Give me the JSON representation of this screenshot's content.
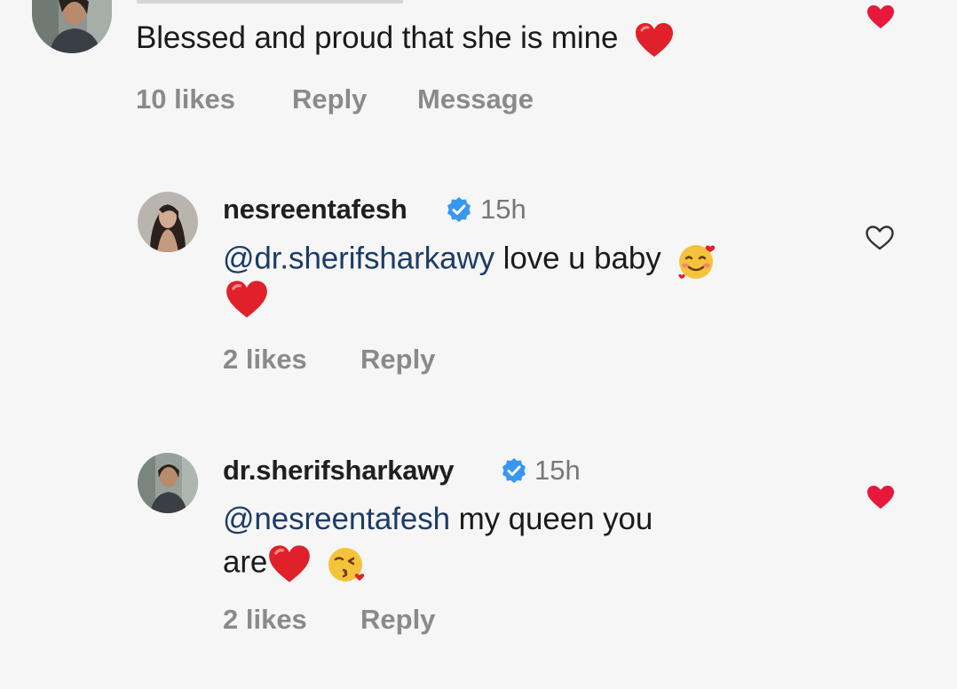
{
  "comments": [
    {
      "text": "Blessed and proud that she is mine",
      "likes": "10 likes",
      "reply": "Reply",
      "message": "Message",
      "liked": true
    },
    {
      "username": "nesreentafesh",
      "time": "15h",
      "mention": "@dr.sherifsharkawy",
      "text": " love u baby",
      "likes": "2 likes",
      "reply": "Reply",
      "liked": false
    },
    {
      "username": "dr.sherifsharkawy",
      "time": "15h",
      "mention": "@nesreentafesh",
      "text": " my queen you",
      "text_line2": "are",
      "likes": "2 likes",
      "reply": "Reply",
      "liked": true
    }
  ],
  "colors": {
    "background": "#f6f6f6",
    "like_red": "#e8173c",
    "verified_blue": "#3897f0",
    "mention": "#1c3b67",
    "meta_gray": "#8a8a8a"
  },
  "icons": {
    "verified": "verified-badge-icon",
    "like_filled": "heart-filled-icon",
    "like_outline": "heart-outline-icon",
    "emoji_heart": "red-heart-emoji",
    "emoji_love": "smiling-face-with-hearts-emoji",
    "emoji_kiss": "face-blowing-kiss-emoji"
  }
}
